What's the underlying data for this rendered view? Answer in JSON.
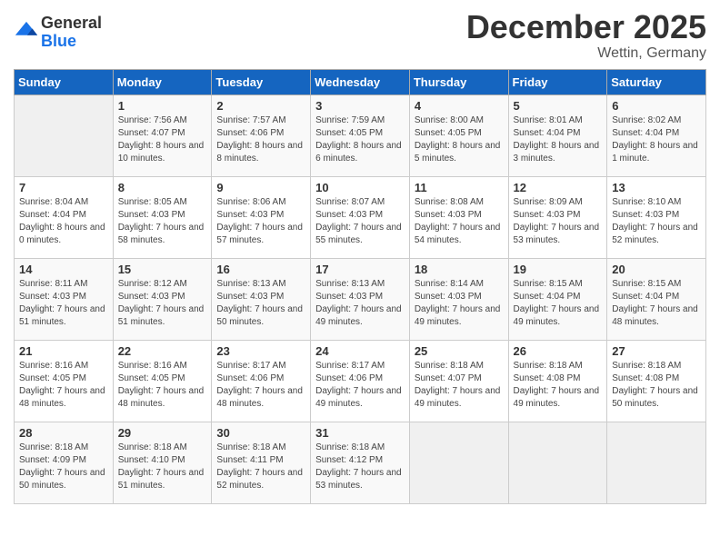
{
  "logo": {
    "general": "General",
    "blue": "Blue"
  },
  "header": {
    "month": "December 2025",
    "location": "Wettin, Germany"
  },
  "weekdays": [
    "Sunday",
    "Monday",
    "Tuesday",
    "Wednesday",
    "Thursday",
    "Friday",
    "Saturday"
  ],
  "weeks": [
    [
      {
        "day": "",
        "sunrise": "",
        "sunset": "",
        "daylight": ""
      },
      {
        "day": "1",
        "sunrise": "Sunrise: 7:56 AM",
        "sunset": "Sunset: 4:07 PM",
        "daylight": "Daylight: 8 hours and 10 minutes."
      },
      {
        "day": "2",
        "sunrise": "Sunrise: 7:57 AM",
        "sunset": "Sunset: 4:06 PM",
        "daylight": "Daylight: 8 hours and 8 minutes."
      },
      {
        "day": "3",
        "sunrise": "Sunrise: 7:59 AM",
        "sunset": "Sunset: 4:05 PM",
        "daylight": "Daylight: 8 hours and 6 minutes."
      },
      {
        "day": "4",
        "sunrise": "Sunrise: 8:00 AM",
        "sunset": "Sunset: 4:05 PM",
        "daylight": "Daylight: 8 hours and 5 minutes."
      },
      {
        "day": "5",
        "sunrise": "Sunrise: 8:01 AM",
        "sunset": "Sunset: 4:04 PM",
        "daylight": "Daylight: 8 hours and 3 minutes."
      },
      {
        "day": "6",
        "sunrise": "Sunrise: 8:02 AM",
        "sunset": "Sunset: 4:04 PM",
        "daylight": "Daylight: 8 hours and 1 minute."
      }
    ],
    [
      {
        "day": "7",
        "sunrise": "Sunrise: 8:04 AM",
        "sunset": "Sunset: 4:04 PM",
        "daylight": "Daylight: 8 hours and 0 minutes."
      },
      {
        "day": "8",
        "sunrise": "Sunrise: 8:05 AM",
        "sunset": "Sunset: 4:03 PM",
        "daylight": "Daylight: 7 hours and 58 minutes."
      },
      {
        "day": "9",
        "sunrise": "Sunrise: 8:06 AM",
        "sunset": "Sunset: 4:03 PM",
        "daylight": "Daylight: 7 hours and 57 minutes."
      },
      {
        "day": "10",
        "sunrise": "Sunrise: 8:07 AM",
        "sunset": "Sunset: 4:03 PM",
        "daylight": "Daylight: 7 hours and 55 minutes."
      },
      {
        "day": "11",
        "sunrise": "Sunrise: 8:08 AM",
        "sunset": "Sunset: 4:03 PM",
        "daylight": "Daylight: 7 hours and 54 minutes."
      },
      {
        "day": "12",
        "sunrise": "Sunrise: 8:09 AM",
        "sunset": "Sunset: 4:03 PM",
        "daylight": "Daylight: 7 hours and 53 minutes."
      },
      {
        "day": "13",
        "sunrise": "Sunrise: 8:10 AM",
        "sunset": "Sunset: 4:03 PM",
        "daylight": "Daylight: 7 hours and 52 minutes."
      }
    ],
    [
      {
        "day": "14",
        "sunrise": "Sunrise: 8:11 AM",
        "sunset": "Sunset: 4:03 PM",
        "daylight": "Daylight: 7 hours and 51 minutes."
      },
      {
        "day": "15",
        "sunrise": "Sunrise: 8:12 AM",
        "sunset": "Sunset: 4:03 PM",
        "daylight": "Daylight: 7 hours and 51 minutes."
      },
      {
        "day": "16",
        "sunrise": "Sunrise: 8:13 AM",
        "sunset": "Sunset: 4:03 PM",
        "daylight": "Daylight: 7 hours and 50 minutes."
      },
      {
        "day": "17",
        "sunrise": "Sunrise: 8:13 AM",
        "sunset": "Sunset: 4:03 PM",
        "daylight": "Daylight: 7 hours and 49 minutes."
      },
      {
        "day": "18",
        "sunrise": "Sunrise: 8:14 AM",
        "sunset": "Sunset: 4:03 PM",
        "daylight": "Daylight: 7 hours and 49 minutes."
      },
      {
        "day": "19",
        "sunrise": "Sunrise: 8:15 AM",
        "sunset": "Sunset: 4:04 PM",
        "daylight": "Daylight: 7 hours and 49 minutes."
      },
      {
        "day": "20",
        "sunrise": "Sunrise: 8:15 AM",
        "sunset": "Sunset: 4:04 PM",
        "daylight": "Daylight: 7 hours and 48 minutes."
      }
    ],
    [
      {
        "day": "21",
        "sunrise": "Sunrise: 8:16 AM",
        "sunset": "Sunset: 4:05 PM",
        "daylight": "Daylight: 7 hours and 48 minutes."
      },
      {
        "day": "22",
        "sunrise": "Sunrise: 8:16 AM",
        "sunset": "Sunset: 4:05 PM",
        "daylight": "Daylight: 7 hours and 48 minutes."
      },
      {
        "day": "23",
        "sunrise": "Sunrise: 8:17 AM",
        "sunset": "Sunset: 4:06 PM",
        "daylight": "Daylight: 7 hours and 48 minutes."
      },
      {
        "day": "24",
        "sunrise": "Sunrise: 8:17 AM",
        "sunset": "Sunset: 4:06 PM",
        "daylight": "Daylight: 7 hours and 49 minutes."
      },
      {
        "day": "25",
        "sunrise": "Sunrise: 8:18 AM",
        "sunset": "Sunset: 4:07 PM",
        "daylight": "Daylight: 7 hours and 49 minutes."
      },
      {
        "day": "26",
        "sunrise": "Sunrise: 8:18 AM",
        "sunset": "Sunset: 4:08 PM",
        "daylight": "Daylight: 7 hours and 49 minutes."
      },
      {
        "day": "27",
        "sunrise": "Sunrise: 8:18 AM",
        "sunset": "Sunset: 4:08 PM",
        "daylight": "Daylight: 7 hours and 50 minutes."
      }
    ],
    [
      {
        "day": "28",
        "sunrise": "Sunrise: 8:18 AM",
        "sunset": "Sunset: 4:09 PM",
        "daylight": "Daylight: 7 hours and 50 minutes."
      },
      {
        "day": "29",
        "sunrise": "Sunrise: 8:18 AM",
        "sunset": "Sunset: 4:10 PM",
        "daylight": "Daylight: 7 hours and 51 minutes."
      },
      {
        "day": "30",
        "sunrise": "Sunrise: 8:18 AM",
        "sunset": "Sunset: 4:11 PM",
        "daylight": "Daylight: 7 hours and 52 minutes."
      },
      {
        "day": "31",
        "sunrise": "Sunrise: 8:18 AM",
        "sunset": "Sunset: 4:12 PM",
        "daylight": "Daylight: 7 hours and 53 minutes."
      },
      {
        "day": "",
        "sunrise": "",
        "sunset": "",
        "daylight": ""
      },
      {
        "day": "",
        "sunrise": "",
        "sunset": "",
        "daylight": ""
      },
      {
        "day": "",
        "sunrise": "",
        "sunset": "",
        "daylight": ""
      }
    ]
  ]
}
